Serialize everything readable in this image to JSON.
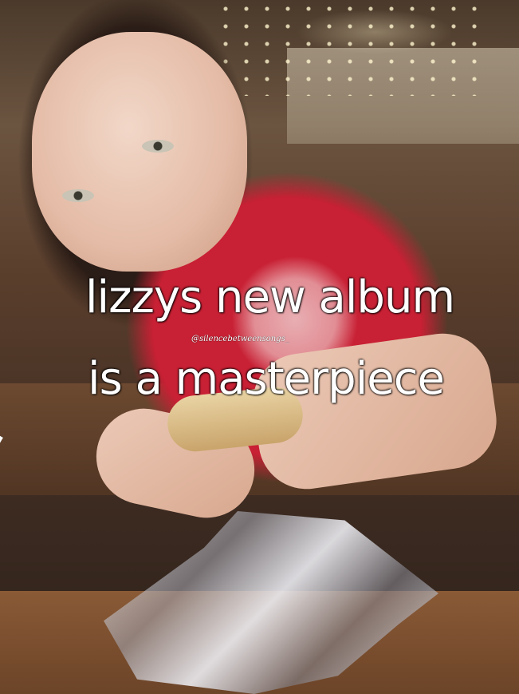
{
  "caption": {
    "line1": "lizzys new album",
    "line2": "is a masterpiece"
  },
  "watermark": "@silencebetweensongs_",
  "colors": {
    "caption_text": "#ffffff",
    "shirt": "#c82034",
    "foil": "#d9d9de"
  }
}
